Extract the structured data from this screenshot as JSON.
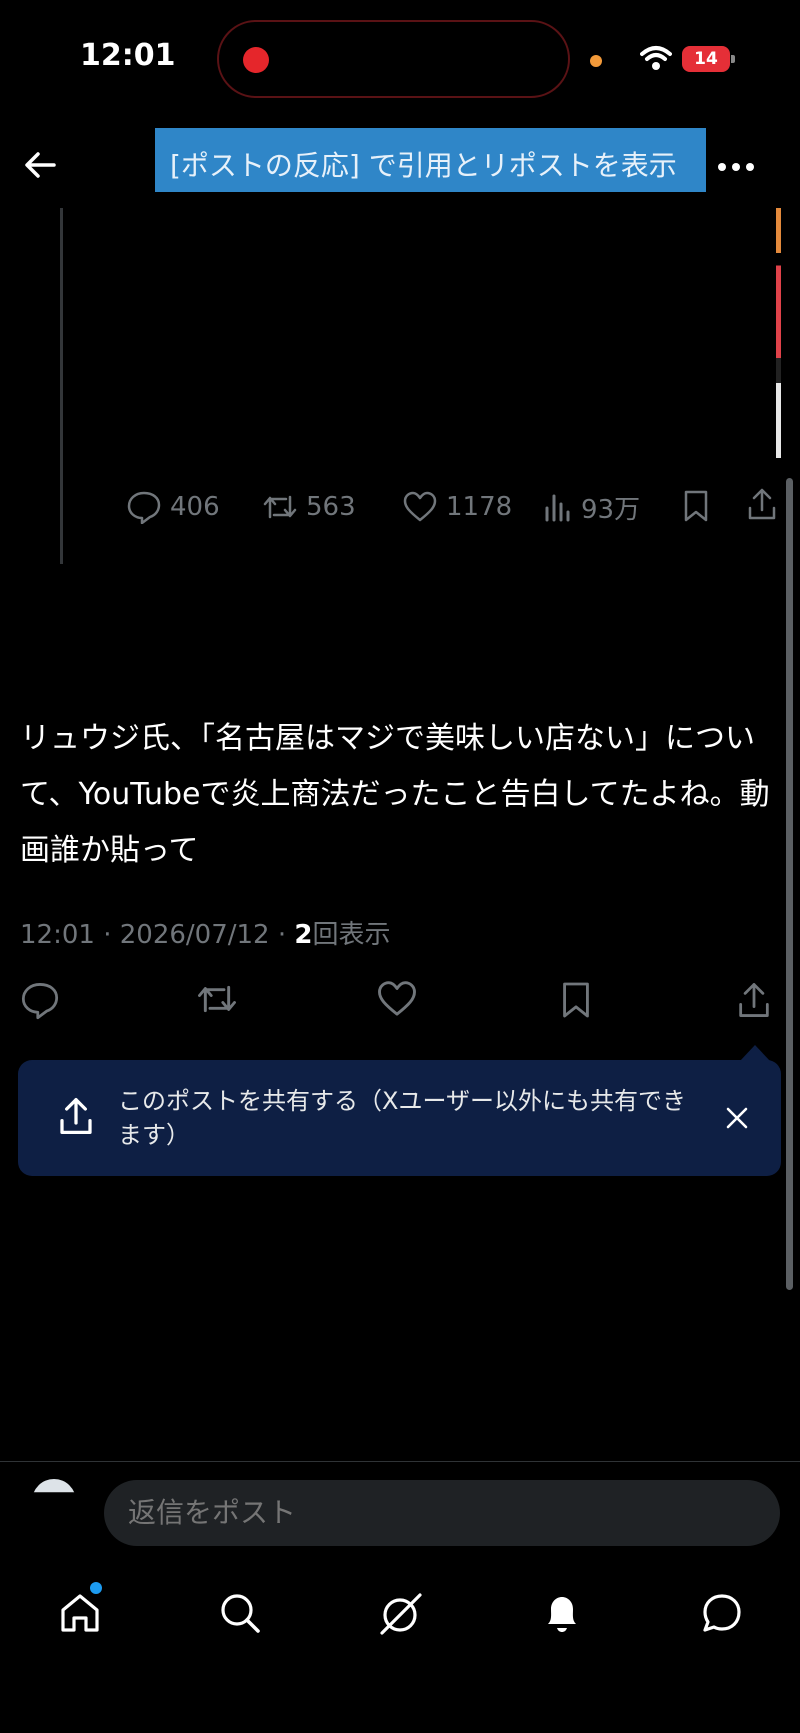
{
  "status_bar": {
    "time": "12:01",
    "battery": "14"
  },
  "header": {
    "quote_banner": "[ポストの反応] で引用とリポストを表示"
  },
  "quoted_metrics": {
    "replies": "406",
    "reposts": "563",
    "likes": "1178",
    "views": "93万"
  },
  "post": {
    "text": "リュウジ氏、「名古屋はマジで美味しい店ない」について、YouTubeで炎上商法だったこと告白してたよね。動画誰か貼って",
    "time": "12:01",
    "date": "2026/07/12",
    "views_count": "2",
    "views_label": "回表示"
  },
  "share_prompt": {
    "text": "このポストを共有する（Xユーザー以外にも共有できます）"
  },
  "reply": {
    "placeholder": "返信をポスト"
  },
  "tabs": [
    "home",
    "search",
    "grok",
    "notifications",
    "messages"
  ],
  "colors": {
    "accent": "#1d9bf0",
    "banner": "#2f86c8",
    "share_prompt_bg": "#0e1f44"
  }
}
